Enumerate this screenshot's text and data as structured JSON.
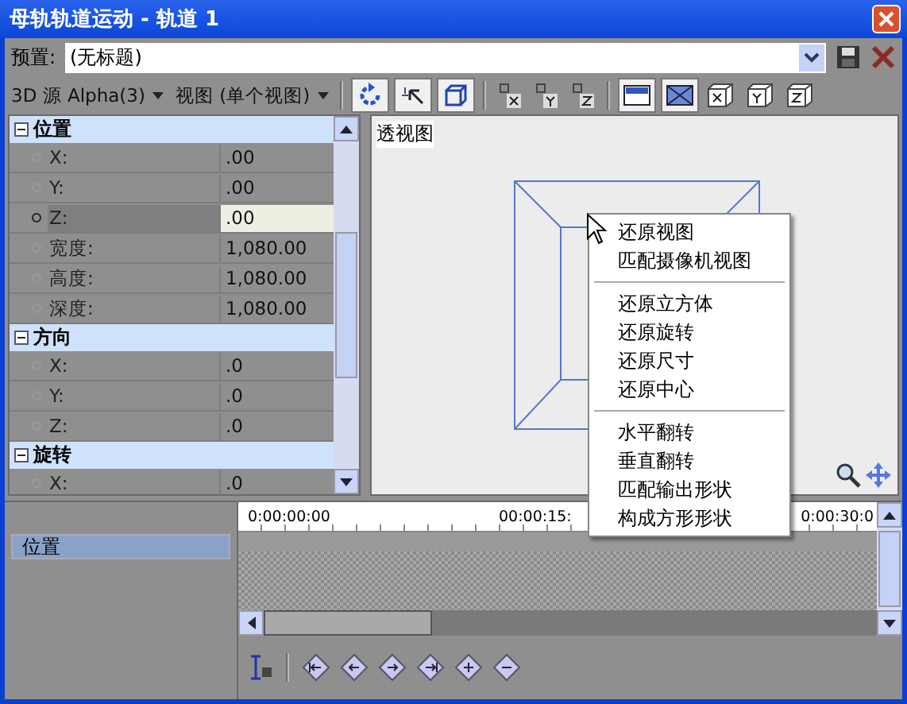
{
  "window": {
    "title": "母轨轨道运动 - 轨道 1"
  },
  "preset": {
    "label": "预置:",
    "value": "(无标题)"
  },
  "toolbar": {
    "source": "3D 源 Alpha(3)",
    "view": "视图 (单个视图)"
  },
  "properties": [
    {
      "name": "位置",
      "expanded": true,
      "rows": [
        {
          "label": "X:",
          "value": ".00",
          "selected": false
        },
        {
          "label": "Y:",
          "value": ".00",
          "selected": false
        },
        {
          "label": "Z:",
          "value": ".00",
          "selected": true
        },
        {
          "label": "宽度:",
          "value": "1,080.00",
          "selected": false
        },
        {
          "label": "高度:",
          "value": "1,080.00",
          "selected": false
        },
        {
          "label": "深度:",
          "value": "1,080.00",
          "selected": false
        }
      ]
    },
    {
      "name": "方向",
      "expanded": true,
      "rows": [
        {
          "label": "X:",
          "value": ".0",
          "selected": false
        },
        {
          "label": "Y:",
          "value": ".0",
          "selected": false
        },
        {
          "label": "Z:",
          "value": ".0",
          "selected": false
        }
      ]
    },
    {
      "name": "旋转",
      "expanded": true,
      "rows": [
        {
          "label": "X:",
          "value": ".0",
          "selected": false
        }
      ]
    }
  ],
  "view": {
    "label": "透视图"
  },
  "context_menu": [
    [
      "还原视图",
      "匹配摄像机视图"
    ],
    [
      "还原立方体",
      "还原旋转",
      "还原尺寸",
      "还原中心"
    ],
    [
      "水平翻转",
      "垂直翻转",
      "匹配输出形状",
      "构成方形形状"
    ]
  ],
  "timeline": {
    "tracks": [
      {
        "label": "位置",
        "selected": true
      }
    ],
    "ruler": [
      "0:00:00:00",
      "00:00:15:",
      "0:00:30:0"
    ]
  }
}
